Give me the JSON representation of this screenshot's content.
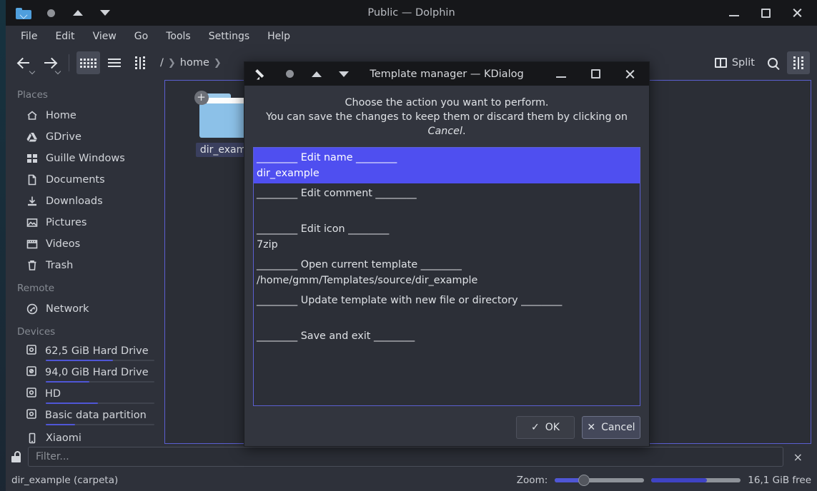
{
  "window": {
    "title": "Public — Dolphin",
    "titlebar_icons": [
      "folder-home-icon",
      "circle-icon",
      "triangle-up-icon",
      "triangle-down-icon"
    ],
    "controls": [
      "minimize",
      "maximize",
      "close"
    ]
  },
  "menubar": {
    "items": [
      "File",
      "Edit",
      "View",
      "Go",
      "Tools",
      "Settings",
      "Help"
    ]
  },
  "toolbar": {
    "back": "back-icon",
    "forward": "forward-icon",
    "view_modes": [
      "icons-view-icon",
      "details-view-icon",
      "compact-view-icon"
    ],
    "breadcrumb": [
      "/",
      "home"
    ],
    "split_label": "Split",
    "search": "search-icon",
    "panel": "compact-view-icon"
  },
  "sidebar": {
    "sections": [
      {
        "title": "Places",
        "items": [
          {
            "label": "Home",
            "icon": "home-icon"
          },
          {
            "label": "GDrive",
            "icon": "gdrive-icon"
          },
          {
            "label": "Guille Windows",
            "icon": "windows-icon"
          },
          {
            "label": "Documents",
            "icon": "document-icon"
          },
          {
            "label": "Downloads",
            "icon": "download-icon"
          },
          {
            "label": "Pictures",
            "icon": "picture-icon"
          },
          {
            "label": "Videos",
            "icon": "video-icon"
          },
          {
            "label": "Trash",
            "icon": "trash-icon"
          }
        ]
      },
      {
        "title": "Remote",
        "items": [
          {
            "label": "Network",
            "icon": "network-icon"
          }
        ]
      },
      {
        "title": "Devices",
        "items": [
          {
            "label": "62,5 GiB Hard Drive",
            "icon": "harddrive-icon",
            "usage": 62
          },
          {
            "label": "94,0 GiB Hard Drive",
            "icon": "harddrive-warning-icon",
            "usage": 40
          },
          {
            "label": "HD",
            "icon": "harddrive-icon",
            "usage": 48
          },
          {
            "label": "Basic data partition",
            "icon": "harddrive-icon",
            "usage": 27
          },
          {
            "label": "Xiaomi",
            "icon": "phone-icon"
          }
        ]
      }
    ]
  },
  "view": {
    "files": [
      {
        "name": "dir_examp",
        "icon": "folder-icon",
        "badge": "+",
        "selected": true
      }
    ]
  },
  "filterbar": {
    "lock_icon": "unlocked-padlock-icon",
    "placeholder": "Filter...",
    "close": "×"
  },
  "statusbar": {
    "selection": "dir_example (carpeta)",
    "zoom_label": "Zoom:",
    "zoom_value": 30,
    "space_used_percent": 62,
    "free_space": "16,1 GiB free"
  },
  "dialog": {
    "title": "Template manager — KDialog",
    "titlebar_icons": [
      "pencil-icon",
      "circle-icon",
      "triangle-up-icon",
      "triangle-down-icon"
    ],
    "prompt_line1": "Choose the action you want to perform.",
    "prompt_line2_pre": "You can save the changes to keep them or discard them by clicking on ",
    "prompt_line2_em": "Cancel",
    "prompt_line2_post": ".",
    "options": [
      {
        "label": "________ Edit name ________",
        "value": "dir_example",
        "selected": true
      },
      {
        "label": "________ Edit comment ________",
        "value": "",
        "selected": false
      },
      {
        "label": "________ Edit icon ________",
        "value": "7zip",
        "selected": false
      },
      {
        "label": "________ Open current template ________",
        "value": "/home/gmm/Templates/source/dir_example",
        "selected": false
      },
      {
        "label": "________ Update template with new file or directory ________",
        "value": "",
        "selected": false
      },
      {
        "label": "________ Save and exit ________",
        "value": "",
        "selected": false
      }
    ],
    "ok_label": "OK",
    "cancel_label": "Cancel",
    "ok_icon": "check-icon",
    "cancel_icon": "cross-icon"
  },
  "colors": {
    "selection": "#4f4ff0",
    "accent_border": "#5b5fd0",
    "titlebar": "#16171a",
    "window_bg": "#2e313a",
    "folder_blue": "#8cc1e8"
  }
}
